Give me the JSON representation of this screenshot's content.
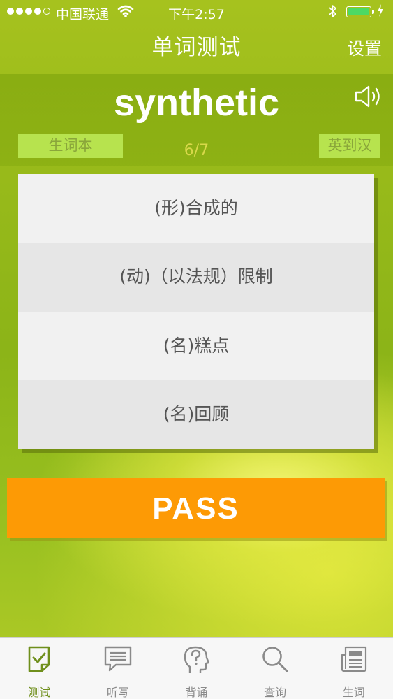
{
  "status_bar": {
    "carrier": "中国联通",
    "time": "下午2:57",
    "signal_dots_filled": 4,
    "signal_dots_total": 5,
    "battery_color": "#4cd964"
  },
  "nav": {
    "title": "单词测试",
    "settings_label": "设置"
  },
  "quiz": {
    "word": "synthetic",
    "vocab_book_label": "生词本",
    "progress": "6/7",
    "mode_label": "英到汉",
    "options": [
      "(形)合成的",
      "(动)（以法规）限制",
      "(名)糕点",
      "(名)回顾"
    ],
    "pass_label": "PASS"
  },
  "colors": {
    "accent": "#fd9a05",
    "tag_bg": "#b7e34e",
    "active_tab": "#6f8f1c"
  },
  "tabs": [
    {
      "label": "测试",
      "icon": "quiz-check-icon",
      "active": true
    },
    {
      "label": "听写",
      "icon": "dictation-speech-icon",
      "active": false
    },
    {
      "label": "背诵",
      "icon": "recite-head-question-icon",
      "active": false
    },
    {
      "label": "查询",
      "icon": "search-icon",
      "active": false
    },
    {
      "label": "生词",
      "icon": "new-words-newspaper-icon",
      "active": false
    }
  ]
}
